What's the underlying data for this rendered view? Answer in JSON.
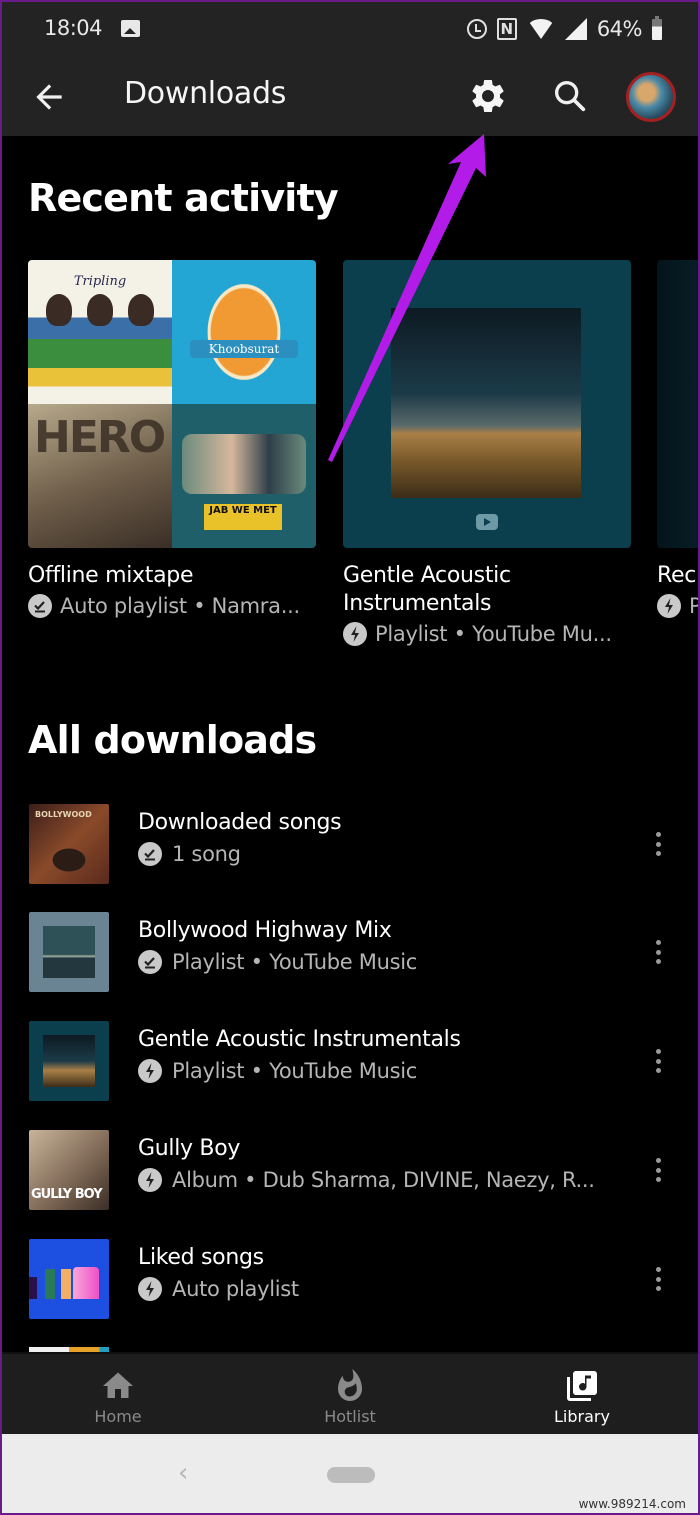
{
  "status_bar": {
    "time": "18:04",
    "battery": "64%",
    "icons": [
      "image-notification-icon",
      "alarm-icon",
      "nfc-icon",
      "wifi-icon",
      "signal-icon",
      "battery-icon"
    ]
  },
  "app_bar": {
    "title": "Downloads",
    "back_icon": "arrow-left-icon",
    "settings_icon": "gear-icon",
    "search_icon": "search-icon",
    "avatar_icon": "profile-avatar"
  },
  "recent_activity": {
    "heading": "Recent activity",
    "cards": [
      {
        "title": "Offline mixtape",
        "status_icon": "downloaded-check-icon",
        "subtitle": "Auto playlist • Namra...",
        "collage": [
          "Tripling",
          "Khoobsurat",
          "HERO",
          "JAB WE MET"
        ]
      },
      {
        "title": "Gentle Acoustic Instrumentals",
        "status_icon": "lightning-icon",
        "subtitle": "Playlist • YouTube Mu..."
      },
      {
        "title": "Rec",
        "status_icon": "lightning-icon",
        "subtitle": "P"
      }
    ]
  },
  "all_downloads": {
    "heading": "All downloads",
    "items": [
      {
        "title": "Downloaded songs",
        "status_icon": "downloaded-check-icon",
        "subtitle": "1 song"
      },
      {
        "title": "Bollywood Highway Mix",
        "status_icon": "downloaded-check-icon",
        "subtitle": "Playlist • YouTube Music"
      },
      {
        "title": "Gentle Acoustic Instrumentals",
        "status_icon": "lightning-icon",
        "subtitle": "Playlist • YouTube Music"
      },
      {
        "title": "Gully Boy",
        "status_icon": "lightning-icon",
        "subtitle": "Album • Dub Sharma, DIVINE, Naezy, R..."
      },
      {
        "title": "Liked songs",
        "status_icon": "lightning-icon",
        "subtitle": "Auto playlist"
      }
    ]
  },
  "bottom_nav": {
    "items": [
      {
        "label": "Home",
        "icon": "home-icon",
        "active": false
      },
      {
        "label": "Hotlist",
        "icon": "flame-icon",
        "active": false
      },
      {
        "label": "Library",
        "icon": "library-music-icon",
        "active": true
      }
    ]
  },
  "system_nav": {
    "back": "‹"
  },
  "watermark": "www.989214.com",
  "colors": {
    "annotation_arrow": "#b31be8",
    "frame_border": "#6a1b8a",
    "app_bar_bg": "#232323",
    "avatar_ring": "#a52020"
  }
}
